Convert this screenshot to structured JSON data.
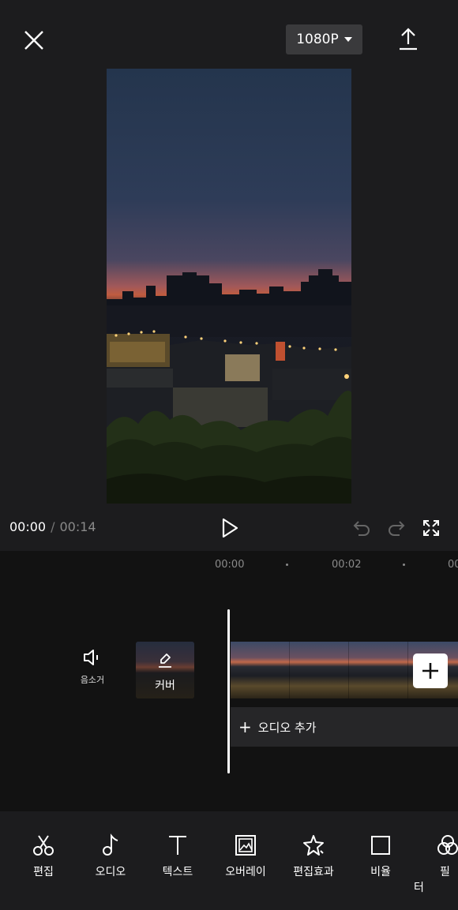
{
  "header": {
    "resolution_label": "1080P"
  },
  "playback": {
    "current_time": "00:00",
    "separator": "/",
    "total_time": "00:14"
  },
  "timeline": {
    "ticks": [
      "00:00",
      "00:02",
      "00"
    ],
    "mute_label": "음소거",
    "cover_label": "커버",
    "add_audio_label": "오디오 추가"
  },
  "toolbar": {
    "items": [
      {
        "label": "편집",
        "icon": "scissors-icon"
      },
      {
        "label": "오디오",
        "icon": "music-note-icon"
      },
      {
        "label": "텍스트",
        "icon": "text-icon"
      },
      {
        "label": "오버레이",
        "icon": "overlay-icon"
      },
      {
        "label": "편집효과",
        "icon": "effects-star-icon"
      },
      {
        "label": "비율",
        "icon": "ratio-square-icon"
      },
      {
        "label": "필터",
        "icon": "filter-icon"
      }
    ]
  },
  "colors": {
    "background": "#1c1c1e",
    "timeline": "#121212",
    "chip": "#3a3a3c",
    "accent": "#ffffff"
  }
}
